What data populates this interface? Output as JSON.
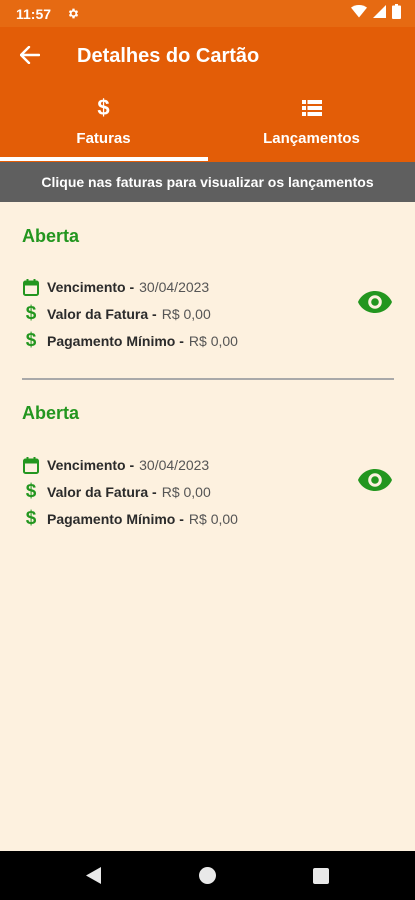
{
  "status_bar": {
    "time": "11:57"
  },
  "app_bar": {
    "title": "Detalhes do Cartão"
  },
  "tabs": [
    {
      "label": "Faturas",
      "icon": "dollar-icon",
      "active": true
    },
    {
      "label": "Lançamentos",
      "icon": "list-icon",
      "active": false
    }
  ],
  "hint": "Clique nas faturas para visualizar os lançamentos",
  "invoices": [
    {
      "status": "Aberta",
      "due_label": "Vencimento -",
      "due_value": "30/04/2023",
      "amount_label": "Valor da Fatura -",
      "amount_value": "R$ 0,00",
      "min_label": "Pagamento Mínimo -",
      "min_value": "R$ 0,00"
    },
    {
      "status": "Aberta",
      "due_label": "Vencimento -",
      "due_value": "30/04/2023",
      "amount_label": "Valor da Fatura -",
      "amount_value": "R$ 0,00",
      "min_label": "Pagamento Mínimo -",
      "min_value": "R$ 0,00"
    }
  ],
  "colors": {
    "primary": "#e35d07",
    "status_bar": "#e66a12",
    "accent_green": "#23961f",
    "background": "#fdf1df",
    "hint_bar": "#5f5f5f"
  }
}
